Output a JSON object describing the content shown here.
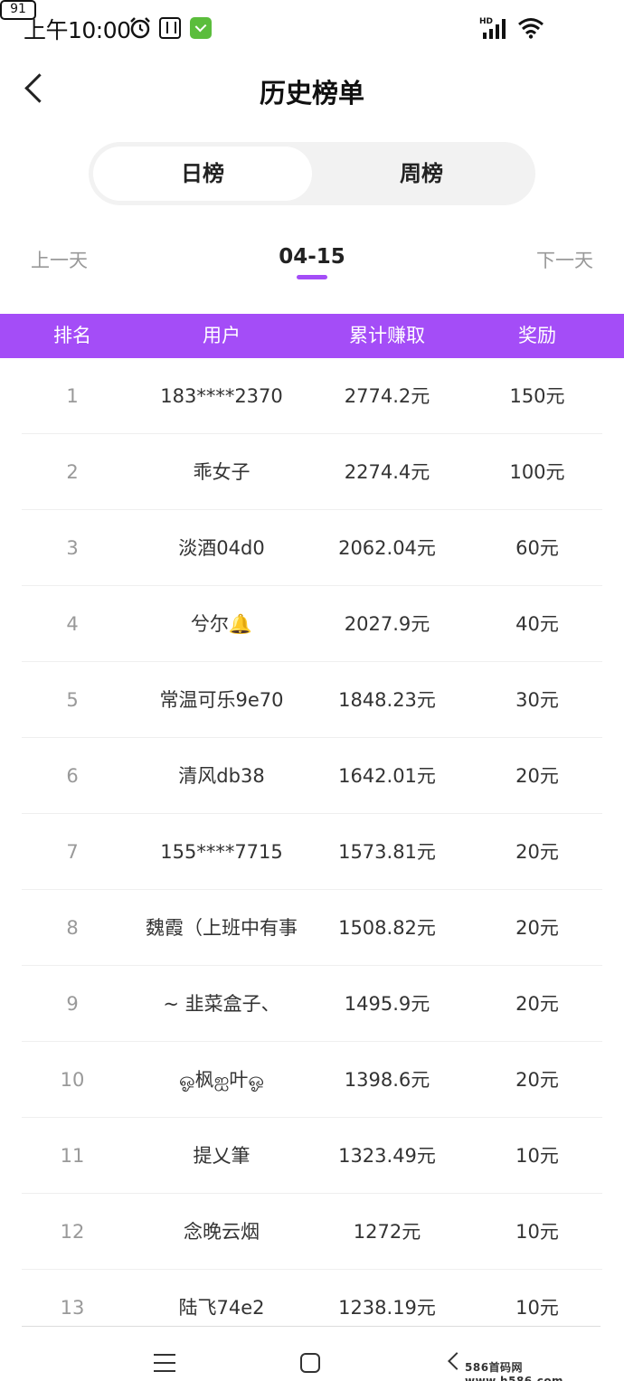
{
  "status_bar": {
    "time": "上午10:00",
    "battery": "91",
    "signal_label": "HD"
  },
  "header": {
    "title": "历史榜单"
  },
  "tabs": [
    {
      "label": "日榜",
      "active": true
    },
    {
      "label": "周榜",
      "active": false
    }
  ],
  "date_nav": {
    "prev": "上一天",
    "current": "04-15",
    "next": "下一天"
  },
  "table": {
    "headers": [
      "排名",
      "用户",
      "累计赚取",
      "奖励"
    ],
    "rows": [
      {
        "rank": "1",
        "user": "183****2370",
        "earned": "2774.2元",
        "reward": "150元"
      },
      {
        "rank": "2",
        "user": "乖女子",
        "earned": "2274.4元",
        "reward": "100元"
      },
      {
        "rank": "3",
        "user": "淡酒04d0",
        "earned": "2062.04元",
        "reward": "60元"
      },
      {
        "rank": "4",
        "user": "兮尔🔔",
        "earned": "2027.9元",
        "reward": "40元"
      },
      {
        "rank": "5",
        "user": "常温可乐9e70",
        "earned": "1848.23元",
        "reward": "30元"
      },
      {
        "rank": "6",
        "user": "清风db38",
        "earned": "1642.01元",
        "reward": "20元"
      },
      {
        "rank": "7",
        "user": "155****7715",
        "earned": "1573.81元",
        "reward": "20元"
      },
      {
        "rank": "8",
        "user": "魏霞（上班中有事",
        "earned": "1508.82元",
        "reward": "20元"
      },
      {
        "rank": "9",
        "user": "~ 韭菜盒子、",
        "earned": "1495.9元",
        "reward": "20元"
      },
      {
        "rank": "10",
        "user": "ஓ枫ஐ叶ஓ",
        "earned": "1398.6元",
        "reward": "20元"
      },
      {
        "rank": "11",
        "user": "提乂筆",
        "earned": "1323.49元",
        "reward": "10元"
      },
      {
        "rank": "12",
        "user": "念晚云烟",
        "earned": "1272元",
        "reward": "10元"
      },
      {
        "rank": "13",
        "user": "陆飞74e2",
        "earned": "1238.19元",
        "reward": "10元"
      }
    ]
  },
  "watermark": "586首码网 www.h586.com",
  "colors": {
    "accent": "#a44df7",
    "tab_bg": "#f2f2f2",
    "muted_text": "#999999"
  }
}
